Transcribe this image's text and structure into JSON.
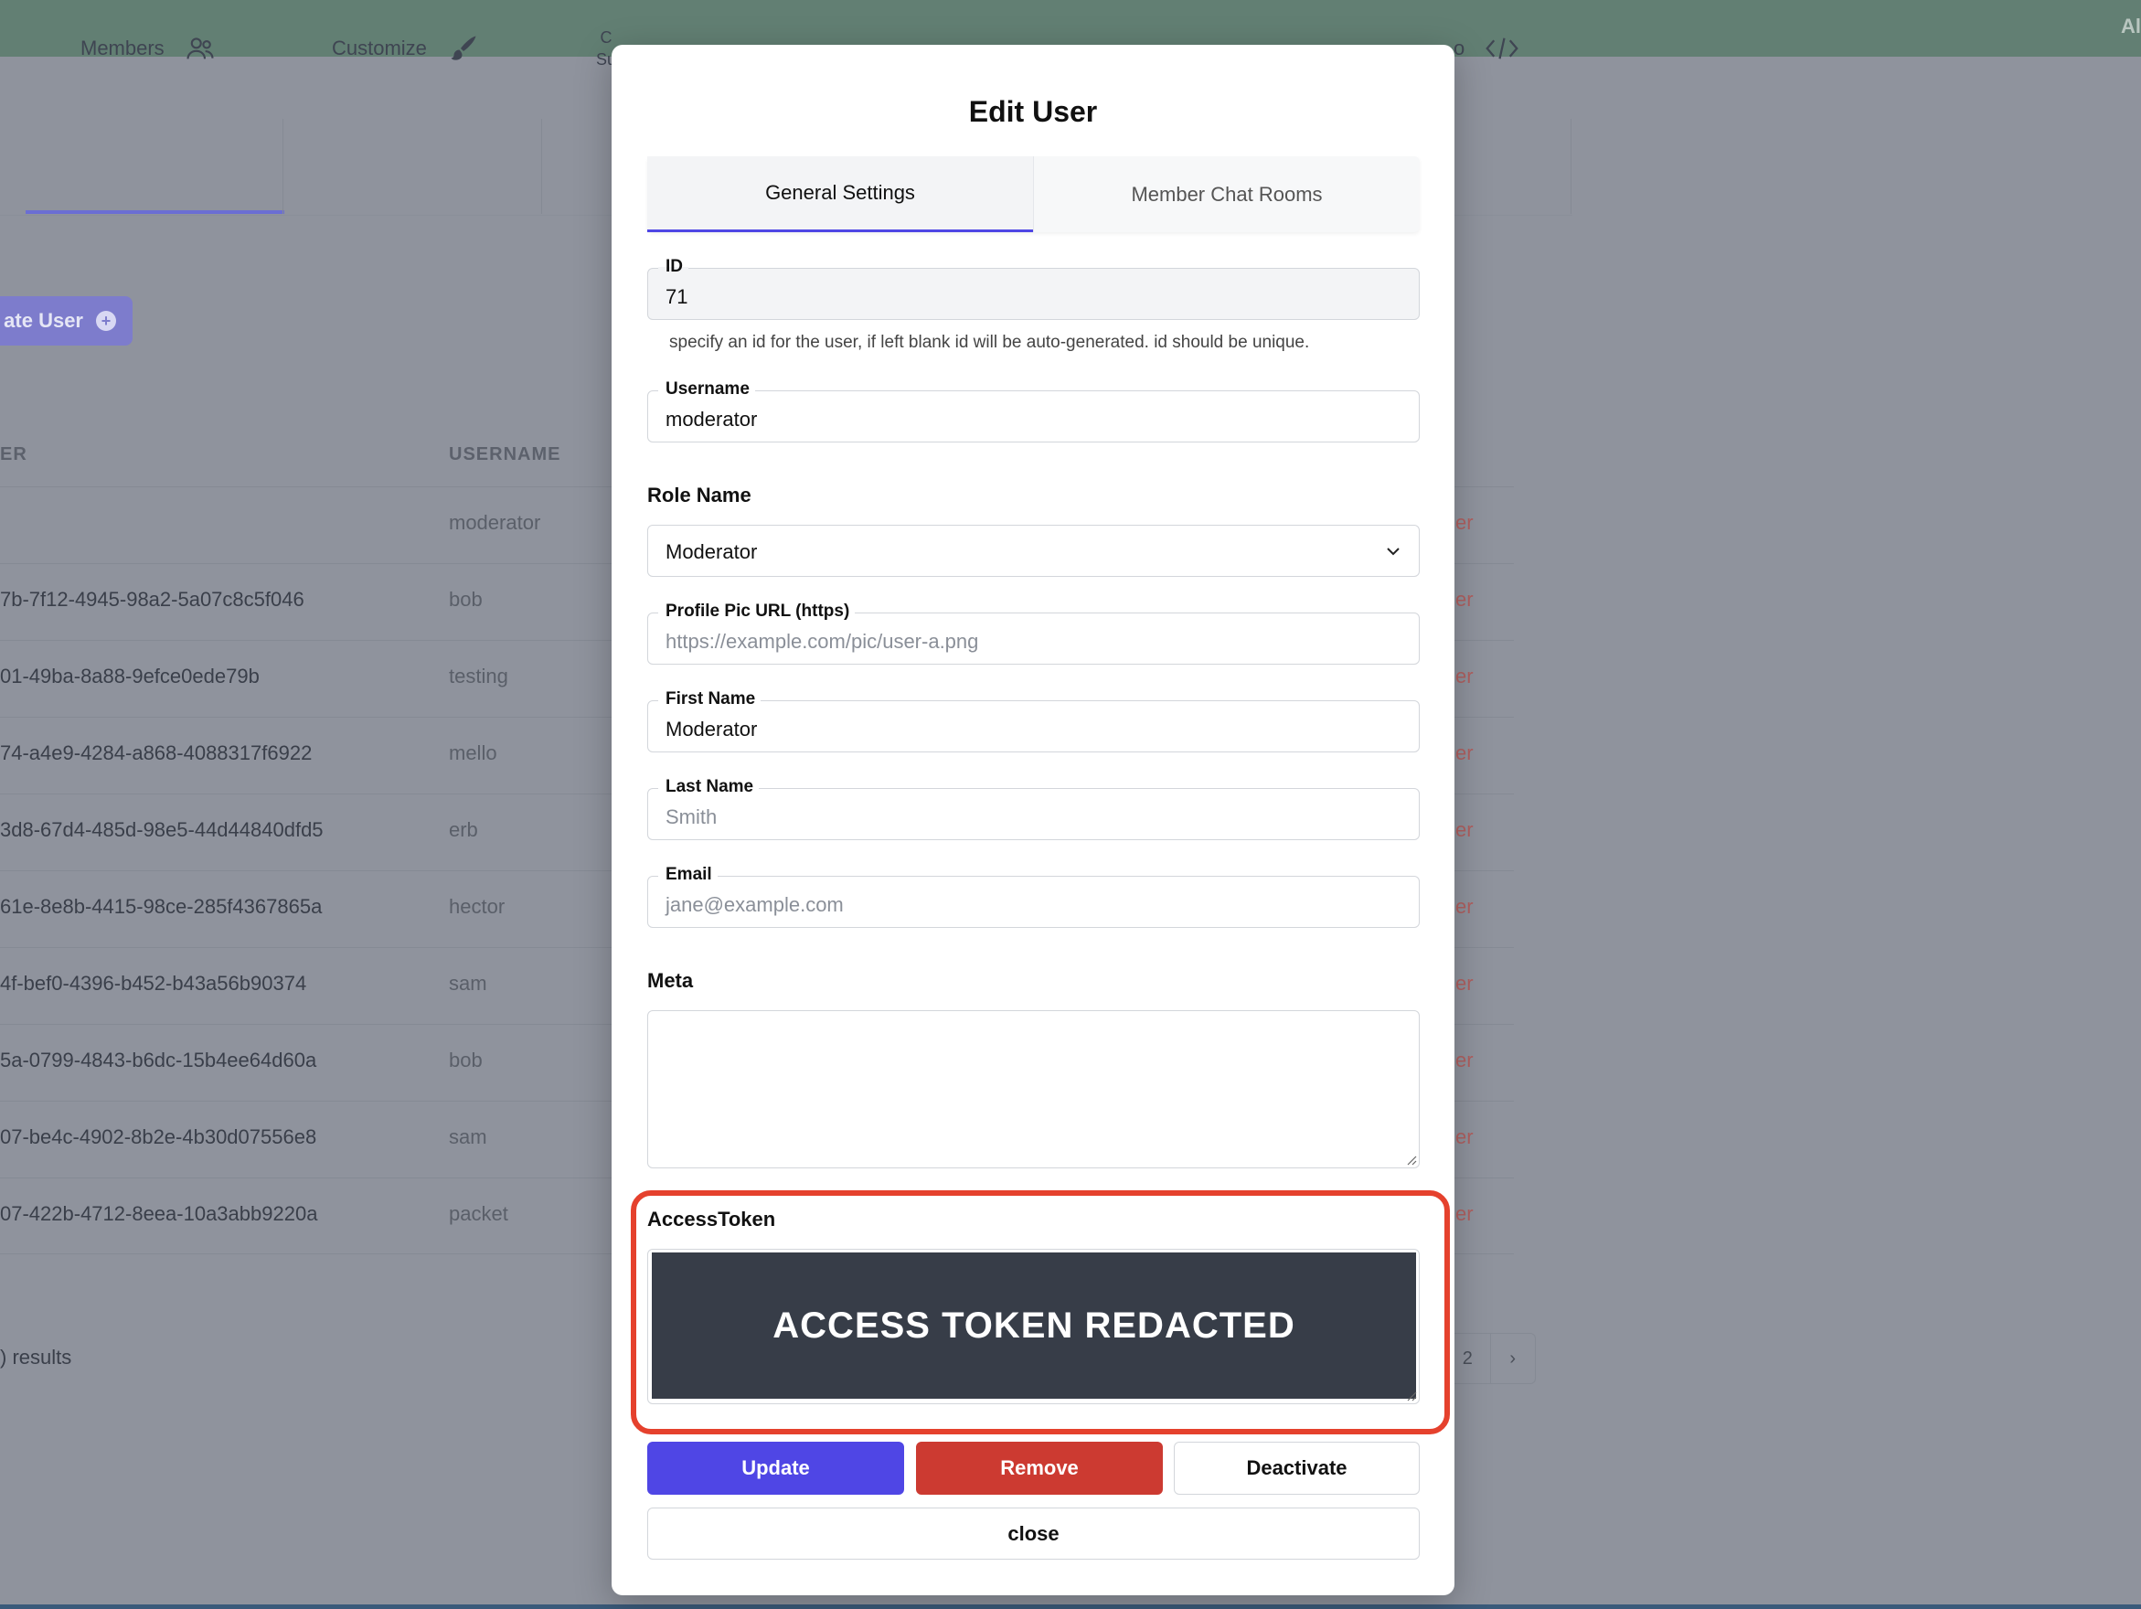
{
  "topbar": {
    "right_text": "Al"
  },
  "background": {
    "tabs": [
      {
        "label": "Members",
        "icon": "users-icon"
      },
      {
        "label": "Customize",
        "icon": "paintbrush-icon"
      },
      {
        "label_line1": "C",
        "label_line2": "Su"
      },
      {
        "label": "o",
        "icon": "code-icon"
      }
    ],
    "create_button": {
      "label": "ate User",
      "icon": "plus-circle-icon"
    },
    "table": {
      "headers": [
        "ER",
        "USERNAME"
      ],
      "rows": [
        {
          "uuid": "",
          "username": "moderator",
          "role": "er"
        },
        {
          "uuid": "7b-7f12-4945-98a2-5a07c8c5f046",
          "username": "bob",
          "role": "er"
        },
        {
          "uuid": "01-49ba-8a88-9efce0ede79b",
          "username": "testing",
          "role": "er"
        },
        {
          "uuid": "74-a4e9-4284-a868-4088317f6922",
          "username": "mello",
          "role": "er"
        },
        {
          "uuid": "3d8-67d4-485d-98e5-44d44840dfd5",
          "username": "erb",
          "role": "er"
        },
        {
          "uuid": "61e-8e8b-4415-98ce-285f4367865a",
          "username": "hector",
          "role": "er"
        },
        {
          "uuid": "4f-bef0-4396-b452-b43a56b90374",
          "username": "sam",
          "role": "er"
        },
        {
          "uuid": "5a-0799-4843-b6dc-15b4ee64d60a",
          "username": "bob",
          "role": "er"
        },
        {
          "uuid": "07-be4c-4902-8b2e-4b30d07556e8",
          "username": "sam",
          "role": "er"
        },
        {
          "uuid": "07-422b-4712-8eea-10a3abb9220a",
          "username": "packet",
          "role": "er"
        }
      ]
    },
    "results_text": ") results",
    "pager": {
      "page": "2",
      "next": "›"
    }
  },
  "modal": {
    "title": "Edit User",
    "tabs": [
      {
        "label": "General Settings",
        "active": true
      },
      {
        "label": "Member Chat Rooms",
        "active": false
      }
    ],
    "id_field": {
      "label": "ID",
      "value": "71"
    },
    "id_help": "specify an id for the user, if left blank id will be auto-generated. id should be unique.",
    "username_field": {
      "label": "Username",
      "value": "moderator"
    },
    "role_label": "Role Name",
    "role_select": {
      "value": "Moderator"
    },
    "profile_pic_field": {
      "label": "Profile Pic URL (https)",
      "placeholder": "https://example.com/pic/user-a.png"
    },
    "first_name_field": {
      "label": "First Name",
      "value": "Moderator"
    },
    "last_name_field": {
      "label": "Last Name",
      "placeholder": "Smith"
    },
    "email_field": {
      "label": "Email",
      "placeholder": "jane@example.com"
    },
    "meta_label": "Meta",
    "access_token_label": "AccessToken",
    "access_token_redaction": "ACCESS TOKEN REDACTED",
    "buttons": {
      "update": "Update",
      "remove": "Remove",
      "deactivate": "Deactivate",
      "close": "close"
    }
  },
  "colors": {
    "accent": "#4f46e5",
    "danger": "#cc3a31",
    "highlight": "#e5412d",
    "topbar": "#627f73"
  }
}
